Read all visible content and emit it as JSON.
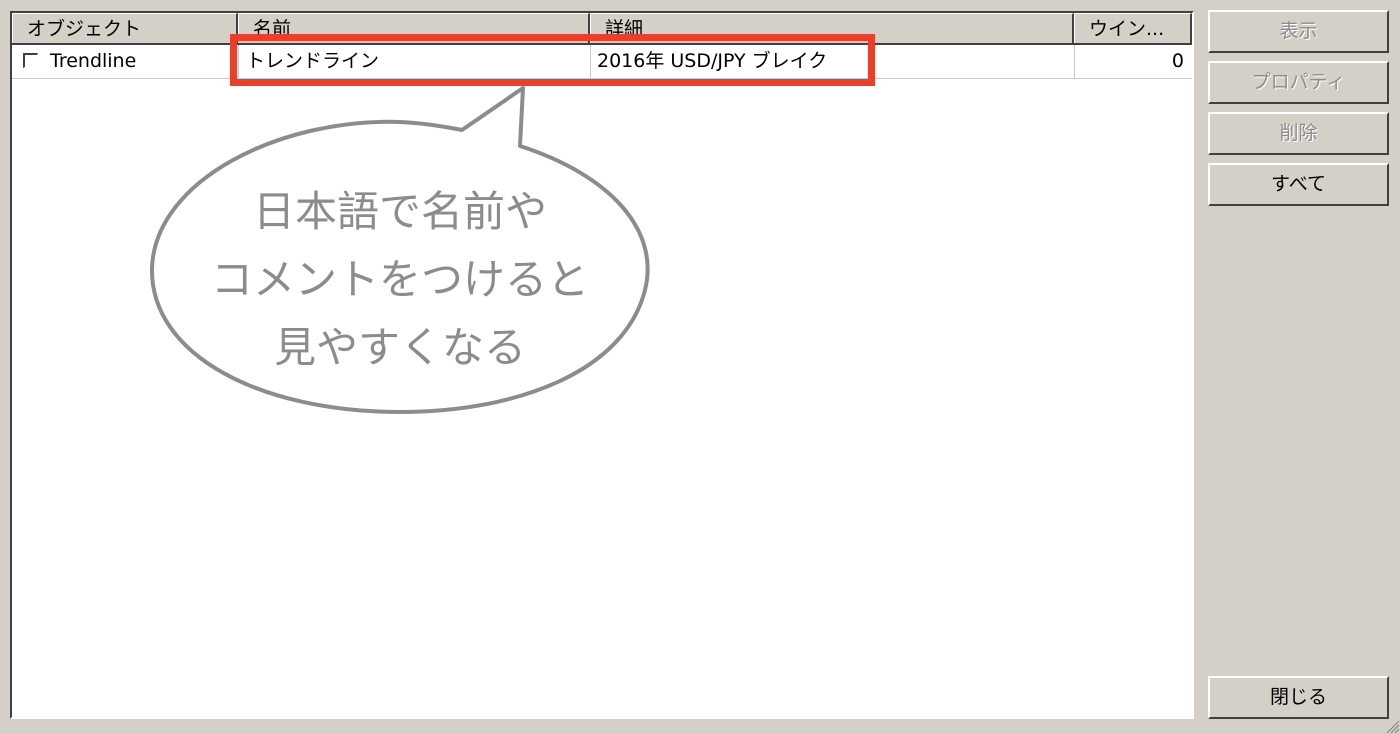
{
  "table": {
    "columns": [
      "オブジェクト",
      "名前",
      "詳細",
      "ウイン..."
    ],
    "rows": [
      {
        "object": "Trendline",
        "name": "トレンドライン",
        "detail": "2016年 USD/JPY ブレイク",
        "window": "0"
      }
    ]
  },
  "buttons": {
    "show": "表示",
    "properties": "プロパティ",
    "delete": "削除",
    "all": "すべて",
    "close": "閉じる"
  },
  "annotation": {
    "line1": "日本語で名前や",
    "line2": "コメントをつけると",
    "line3": "見やすくなる"
  },
  "colors": {
    "highlight": "#e8402a",
    "bubble_text": "#8c8c8c",
    "window_bg": "#d4d0c8"
  }
}
